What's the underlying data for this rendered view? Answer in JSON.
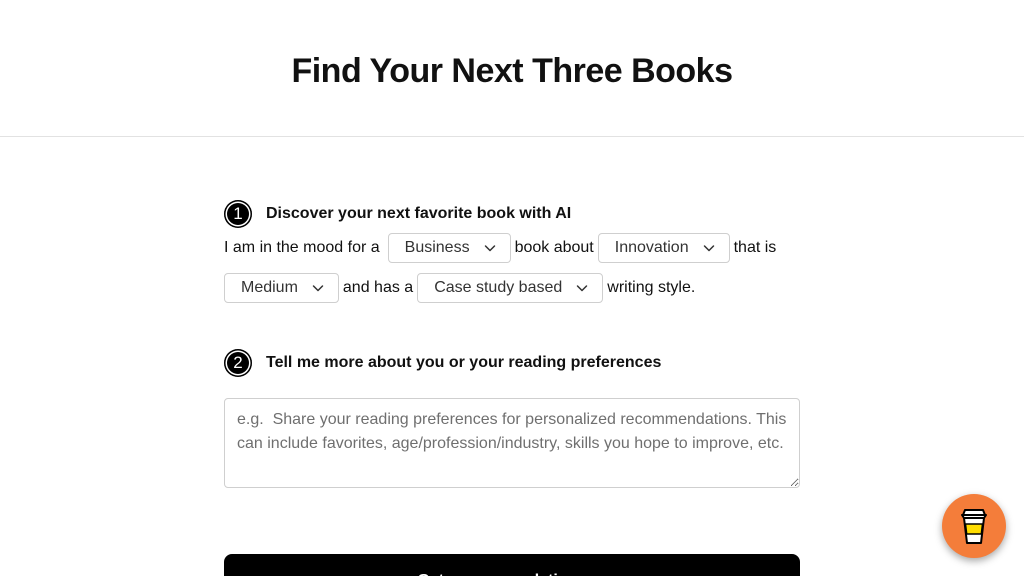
{
  "header": {
    "title": "Find Your Next Three Books"
  },
  "step1": {
    "number": "1",
    "title": "Discover your next favorite book with AI",
    "text_mood": "I am in the mood for a",
    "genre": "Business",
    "text_about": "book about",
    "topic": "Innovation",
    "text_that_is": "that is",
    "level": "Medium",
    "text_has": "and has a",
    "style": "Case study based",
    "text_style": "writing style."
  },
  "step2": {
    "number": "2",
    "title": "Tell me more about you or your reading preferences",
    "placeholder": "e.g.  Share your reading preferences for personalized recommendations. This can include favorites, age/profession/industry, skills you hope to improve, etc."
  },
  "submit": {
    "label": "Get recommendations →"
  },
  "coffee": {
    "icon": "coffee-cup-icon",
    "color": "#f47d3a"
  }
}
